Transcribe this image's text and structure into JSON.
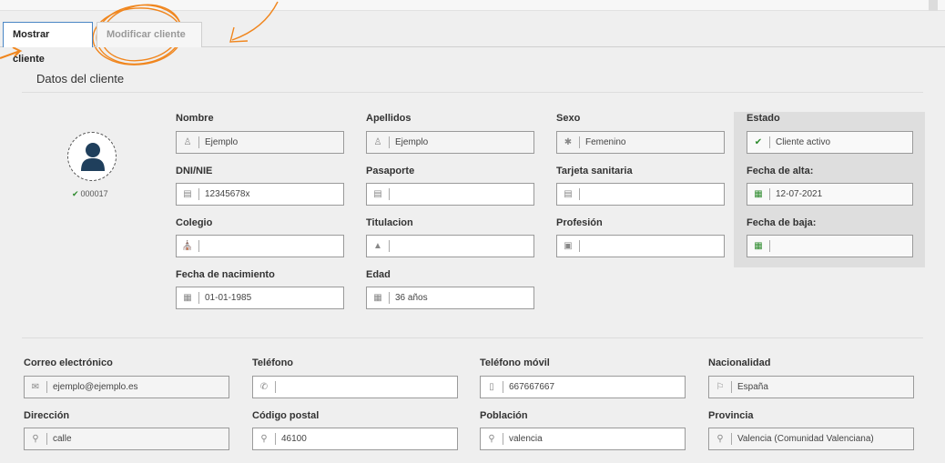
{
  "tabs": {
    "show": "Mostrar cliente",
    "edit": "Modificar cliente"
  },
  "section_title": "Datos del cliente",
  "client": {
    "id": "000017"
  },
  "fields": {
    "nombre": {
      "label": "Nombre",
      "value": "Ejemplo",
      "icon": "user-icon"
    },
    "apellidos": {
      "label": "Apellidos",
      "value": "Ejemplo",
      "icon": "user-icon"
    },
    "sexo": {
      "label": "Sexo",
      "value": "Femenino",
      "icon": "asterisk-icon"
    },
    "estado": {
      "label": "Estado",
      "value": "Cliente activo",
      "icon": "check-icon"
    },
    "dni": {
      "label": "DNI/NIE",
      "value": "12345678x",
      "icon": "id-card-icon"
    },
    "pasaporte": {
      "label": "Pasaporte",
      "value": "",
      "icon": "id-card-icon"
    },
    "tarjeta": {
      "label": "Tarjeta sanitaria",
      "value": "",
      "icon": "id-card-icon"
    },
    "fecha_alta": {
      "label": "Fecha de alta:",
      "value": "12-07-2021",
      "icon": "calendar-icon"
    },
    "colegio": {
      "label": "Colegio",
      "value": "",
      "icon": "institution-icon"
    },
    "titulacion": {
      "label": "Titulacion",
      "value": "",
      "icon": "graduation-cap-icon"
    },
    "profesion": {
      "label": "Profesión",
      "value": "",
      "icon": "briefcase-icon"
    },
    "fecha_baja": {
      "label": "Fecha de baja:",
      "value": "",
      "icon": "calendar-icon"
    },
    "nacimiento": {
      "label": "Fecha de nacimiento",
      "value": "01-01-1985",
      "icon": "calendar-icon"
    },
    "edad": {
      "label": "Edad",
      "value": "36 años",
      "icon": "calendar-icon"
    },
    "email": {
      "label": "Correo electrónico",
      "value": "ejemplo@ejemplo.es",
      "icon": "envelope-icon"
    },
    "telefono": {
      "label": "Teléfono",
      "value": "",
      "icon": "phone-icon"
    },
    "movil": {
      "label": "Teléfono móvil",
      "value": "667667667",
      "icon": "mobile-icon"
    },
    "nacionalidad": {
      "label": "Nacionalidad",
      "value": "España",
      "icon": "flag-icon"
    },
    "direccion": {
      "label": "Dirección",
      "value": "calle",
      "icon": "map-marker-icon"
    },
    "cp": {
      "label": "Código postal",
      "value": "46100",
      "icon": "map-marker-icon"
    },
    "poblacion": {
      "label": "Población",
      "value": "valencia",
      "icon": "map-marker-icon"
    },
    "provincia": {
      "label": "Provincia",
      "value": "Valencia  (Comunidad Valenciana)",
      "icon": "map-marker-icon"
    }
  },
  "colors": {
    "accent_tab": "#4a86c5",
    "ok_green": "#2e8b2e",
    "avatar": "#1f3f5c",
    "annotation": "#f0861e"
  }
}
